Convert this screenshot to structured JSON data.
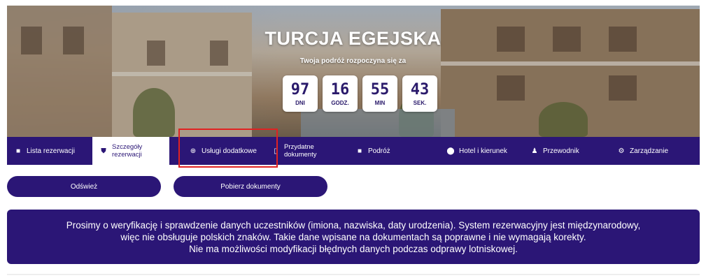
{
  "hero": {
    "title": "TURCJA EGEJSKA",
    "subtitle": "Twoja podróż rozpoczyna się za",
    "countdown": [
      {
        "value": "97",
        "unit": "DNI"
      },
      {
        "value": "16",
        "unit": "GODZ."
      },
      {
        "value": "55",
        "unit": "MIN"
      },
      {
        "value": "43",
        "unit": "SEK."
      }
    ]
  },
  "nav": {
    "items": [
      {
        "label": "Lista rezerwacji",
        "icon": "list-icon"
      },
      {
        "label": "Szczegóły rezerwacji",
        "icon": "shield-icon"
      },
      {
        "label": "Usługi dodatkowe",
        "icon": "plus-circle-icon"
      },
      {
        "label": "Przydatne dokumenty",
        "icon": "document-icon"
      },
      {
        "label": "Podróż",
        "icon": "suitcase-icon"
      },
      {
        "label": "Hotel i kierunek",
        "icon": "map-pin-icon"
      },
      {
        "label": "Przewodnik",
        "icon": "people-icon"
      },
      {
        "label": "Zarządzanie",
        "icon": "gear-icon"
      }
    ],
    "active_index": 1,
    "highlighted_index": 2
  },
  "actions": {
    "refresh_label": "Odśwież",
    "download_label": "Pobierz dokumenty"
  },
  "notice": {
    "line1": "Prosimy o weryfikację i sprawdzenie danych uczestników (imiona, nazwiska, daty urodzenia). System rezerwacyjny jest międzynarodowy,",
    "line2": "więc nie obsługuje polskich znaków. Takie dane wpisane na dokumentach są poprawne i nie wymagają korekty.",
    "line3": "Nie ma możliwości modyfikacji błędnych danych podczas odprawy lotniskowej."
  },
  "colors": {
    "brand": "#2b1676",
    "highlight": "#e02222"
  }
}
